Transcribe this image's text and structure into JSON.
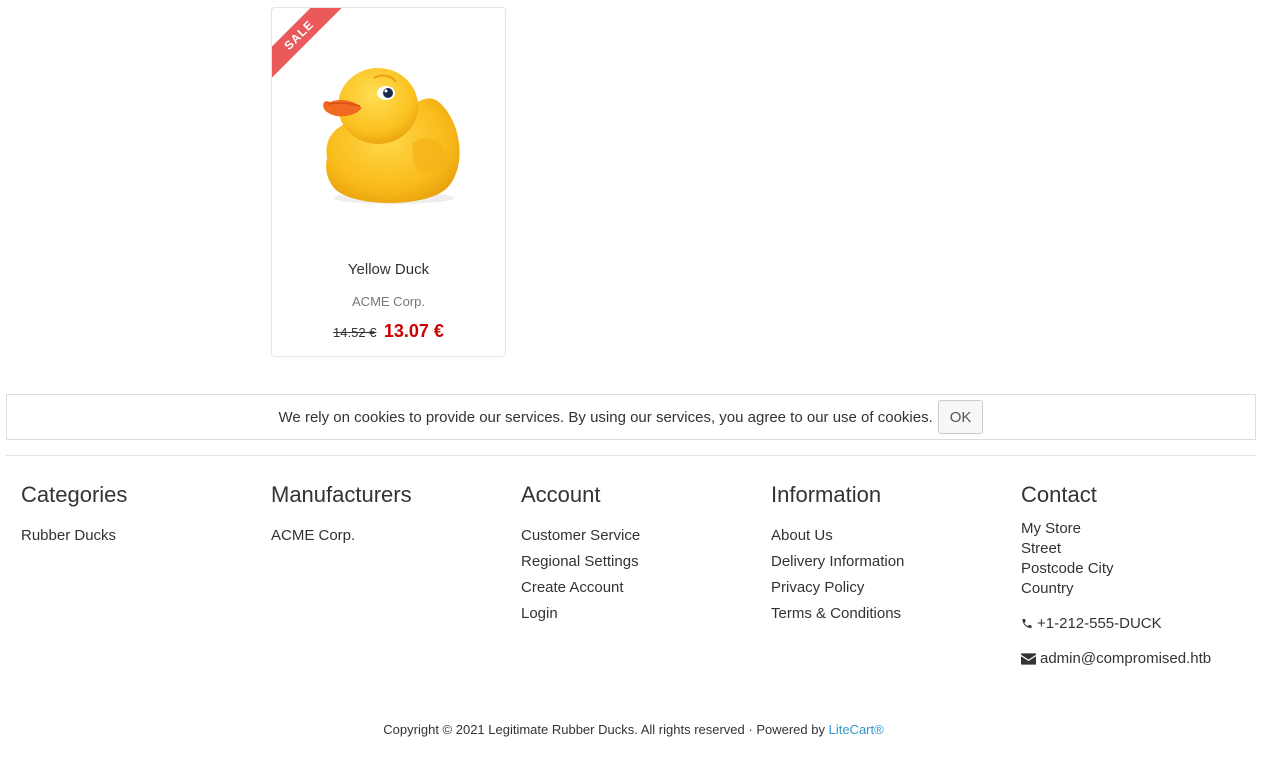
{
  "colors": {
    "sale_ribbon": "#ea5a5a",
    "campaign_price": "#cc0000",
    "link": "#3399cc"
  },
  "product": {
    "badge": "SALE",
    "name": "Yellow Duck",
    "manufacturer": "ACME Corp.",
    "regular_price": "14.52 €",
    "campaign_price": "13.07 €",
    "image_icon": "rubber-duck-image"
  },
  "cookie_notice": {
    "text": "We rely on cookies to provide our services. By using our services, you agree to our use of cookies.",
    "ok_label": "OK"
  },
  "footer": {
    "categories": {
      "title": "Categories",
      "items": [
        "Rubber Ducks"
      ]
    },
    "manufacturers": {
      "title": "Manufacturers",
      "items": [
        "ACME Corp."
      ]
    },
    "account": {
      "title": "Account",
      "items": [
        "Customer Service",
        "Regional Settings",
        "Create Account",
        "Login"
      ]
    },
    "information": {
      "title": "Information",
      "items": [
        "About Us",
        "Delivery Information",
        "Privacy Policy",
        "Terms & Conditions"
      ]
    },
    "contact": {
      "title": "Contact",
      "address": [
        "My Store",
        "Street",
        "Postcode City",
        "Country"
      ],
      "phone": "+1-212-555-DUCK",
      "phone_icon": "phone-icon",
      "email": "admin@compromised.htb",
      "email_icon": "envelope-icon"
    }
  },
  "copyright": {
    "text": "Copyright © 2021 Legitimate Rubber Ducks. All rights reserved · Powered by ",
    "link": "LiteCart®"
  }
}
